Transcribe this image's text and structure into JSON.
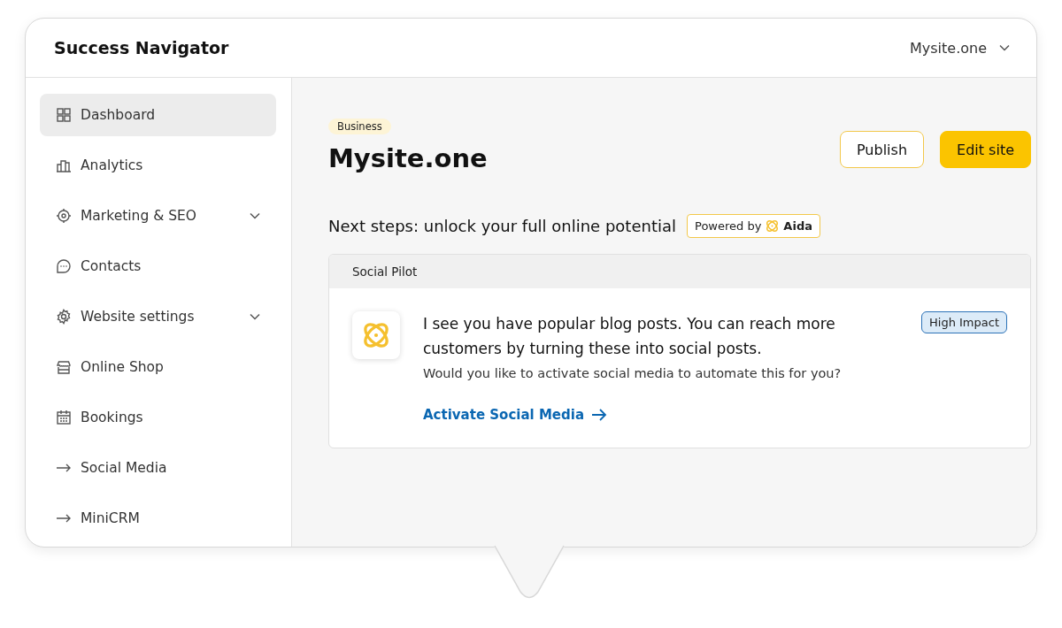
{
  "header": {
    "title": "Success Navigator",
    "site_menu": "Mysite.one"
  },
  "sidebar": {
    "items": [
      {
        "label": "Dashboard",
        "selected": true,
        "submenu": false
      },
      {
        "label": "Analytics",
        "selected": false,
        "submenu": false
      },
      {
        "label": "Marketing & SEO",
        "selected": false,
        "submenu": true
      },
      {
        "label": "Contacts",
        "selected": false,
        "submenu": false
      },
      {
        "label": "Website settings",
        "selected": false,
        "submenu": true
      },
      {
        "label": "Online Shop",
        "selected": false,
        "submenu": false
      },
      {
        "label": "Bookings",
        "selected": false,
        "submenu": false
      },
      {
        "label": "Social Media",
        "selected": false,
        "submenu": false
      },
      {
        "label": "MiniCRM",
        "selected": false,
        "submenu": false
      }
    ]
  },
  "site": {
    "badge": "Business",
    "name": "Mysite.one",
    "buttons": [
      {
        "label": "Publish",
        "kind": "outline"
      },
      {
        "label": "Edit site",
        "kind": "primary"
      }
    ]
  },
  "next_steps": {
    "title": "Next steps: unlock your full online potential",
    "powered_by": "Powered by",
    "brand": "Aida"
  },
  "card": {
    "header": "Social Pilot",
    "headline": "I see you have popular blog posts. You can reach more customers by turning these into social posts.",
    "question": "Would you like to activate social media to automate this for you?",
    "tag": "High Impact",
    "link": "Activate Social Media"
  }
}
